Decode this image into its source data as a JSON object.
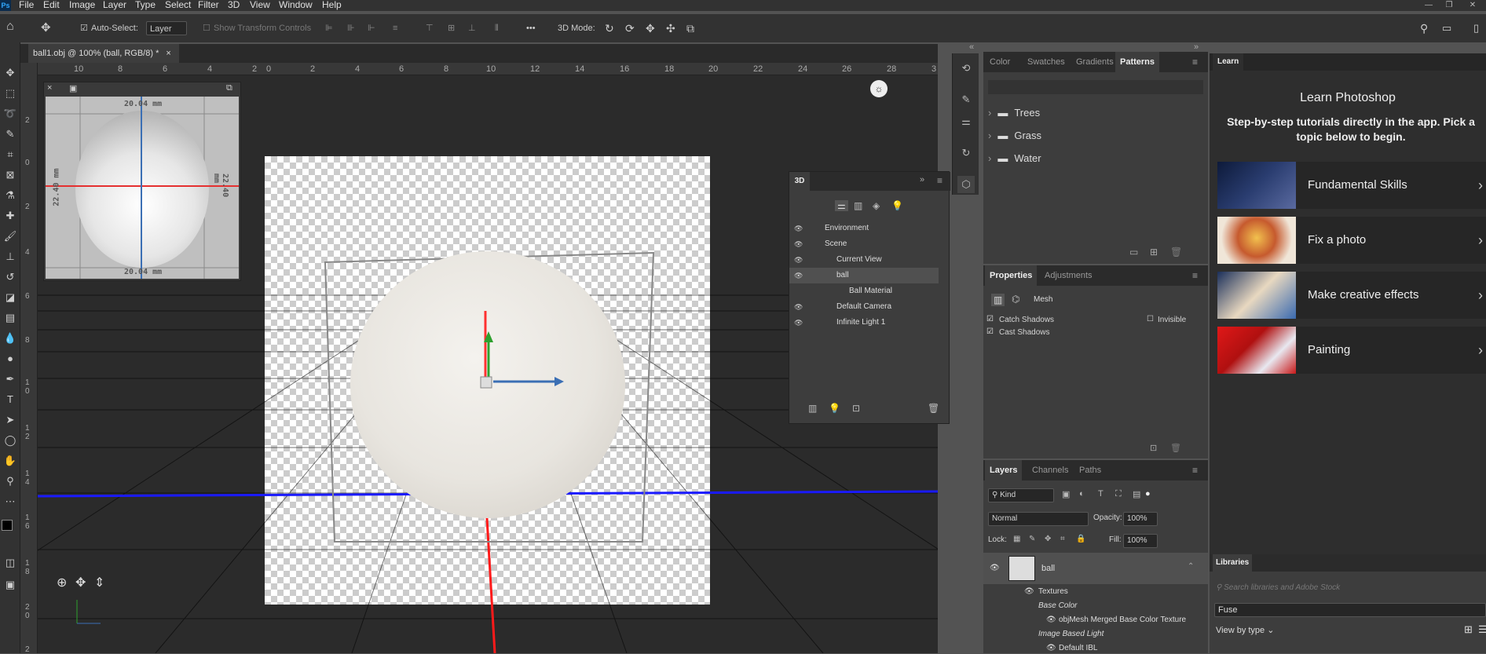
{
  "app": {
    "logo": "Ps"
  },
  "menu": [
    "File",
    "Edit",
    "Image",
    "Layer",
    "Type",
    "Select",
    "Filter",
    "3D",
    "View",
    "Window",
    "Help"
  ],
  "options": {
    "auto_select_label": "Auto-Select:",
    "auto_select_value": "Layer",
    "transform_label": "Show Transform Controls",
    "more": "•••",
    "mode3d_label": "3D Mode:"
  },
  "document": {
    "tab_title": "ball1.obj @ 100% (ball, RGB/8) *",
    "close": "×"
  },
  "ruler": {
    "top": [
      "10",
      "8",
      "6",
      "4",
      "2",
      "0",
      "2",
      "4",
      "6",
      "8",
      "10",
      "12",
      "14",
      "16",
      "18",
      "20",
      "22",
      "24",
      "26",
      "28",
      "3"
    ],
    "left": [
      "2",
      "0",
      "2",
      "4",
      "6",
      "8",
      "1 0",
      "1 2",
      "1 4",
      "1 6",
      "1 8",
      "2 0",
      "2"
    ]
  },
  "secondary_view": {
    "dim_top": "20.04 mm",
    "dim_bottom": "20.04 mm",
    "dim_left": "22.40 mm",
    "dim_right": "22.40 mm"
  },
  "panel3d": {
    "title": "3D",
    "items": [
      {
        "label": "Environment",
        "indent": 0
      },
      {
        "label": "Scene",
        "indent": 0
      },
      {
        "label": "Current View",
        "indent": 1
      },
      {
        "label": "ball",
        "indent": 1,
        "selected": true
      },
      {
        "label": "Ball Material",
        "indent": 2
      },
      {
        "label": "Default Camera",
        "indent": 1
      },
      {
        "label": "Infinite Light 1",
        "indent": 1
      }
    ]
  },
  "patterns_panel": {
    "tabs": [
      "Color",
      "Swatches",
      "Gradients",
      "Patterns"
    ],
    "active": "Patterns",
    "folders": [
      "Trees",
      "Grass",
      "Water"
    ]
  },
  "properties_panel": {
    "tabs": [
      "Properties",
      "Adjustments"
    ],
    "active": "Properties",
    "type": "Mesh",
    "catch_shadows": "Catch Shadows",
    "cast_shadows": "Cast Shadows",
    "invisible": "Invisible"
  },
  "layers_panel": {
    "tabs": [
      "Layers",
      "Channels",
      "Paths"
    ],
    "active": "Layers",
    "kind": "Kind",
    "blend": "Normal",
    "opacity_label": "Opacity:",
    "opacity": "100%",
    "lock_label": "Lock:",
    "fill_label": "Fill:",
    "fill": "100%",
    "layer_name": "ball",
    "sub": [
      "Textures",
      "Base Color",
      "objMesh Merged Base Color Texture",
      "Image Based Light",
      "Default IBL"
    ]
  },
  "learn": {
    "tab": "Learn",
    "title": "Learn Photoshop",
    "subtitle": "Step-by-step tutorials directly in the app. Pick a topic below to begin.",
    "cards": [
      "Fundamental Skills",
      "Fix a photo",
      "Make creative effects",
      "Painting"
    ]
  },
  "libraries": {
    "tab": "Libraries",
    "search_placeholder": "Search libraries and Adobe Stock",
    "library": "Fuse",
    "view_by": "View by type"
  },
  "colors": {
    "accent": "#31a8ff",
    "panel": "#3d3d3d",
    "dark": "#323232"
  }
}
